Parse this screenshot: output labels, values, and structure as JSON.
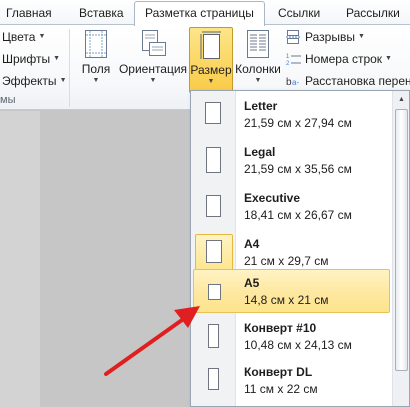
{
  "tabs": [
    {
      "label": "Главная"
    },
    {
      "label": "Вставка"
    },
    {
      "label": "Разметка страницы",
      "active": true
    },
    {
      "label": "Ссылки"
    },
    {
      "label": "Рассылки"
    }
  ],
  "ribbon": {
    "themes": {
      "colors": "Цвета",
      "fonts": "Шрифты",
      "effects": "Эффекты",
      "group_label": "мы"
    },
    "margins_label": "Поля",
    "orientation_label": "Ориентация",
    "size_label": "Размер",
    "columns_label": "Колонки",
    "breaks_label": "Разрывы",
    "line_numbers_label": "Номера строк",
    "hyphenation_label": "Расстановка перено"
  },
  "size_menu": {
    "items": [
      {
        "name": "Letter",
        "dims": "21,59 см x 27,94 см"
      },
      {
        "name": "Legal",
        "dims": "21,59 см x 35,56 см"
      },
      {
        "name": "Executive",
        "dims": "18,41 см x 26,67 см"
      },
      {
        "name": "A4",
        "dims": "21 см x 29,7 см",
        "selected": true
      },
      {
        "name": "A5",
        "dims": "14,8 см x 21 см",
        "highlighted": true
      },
      {
        "name": "Конверт #10",
        "dims": "10,48 см x 24,13 см"
      },
      {
        "name": "Конверт DL",
        "dims": "11 см x 22 см"
      }
    ]
  },
  "colors": {
    "highlight": "#fde58a",
    "arrow": "#e02020"
  },
  "icons": {
    "scroll_up": "triangle-up",
    "dropdown": "triangle-down"
  }
}
